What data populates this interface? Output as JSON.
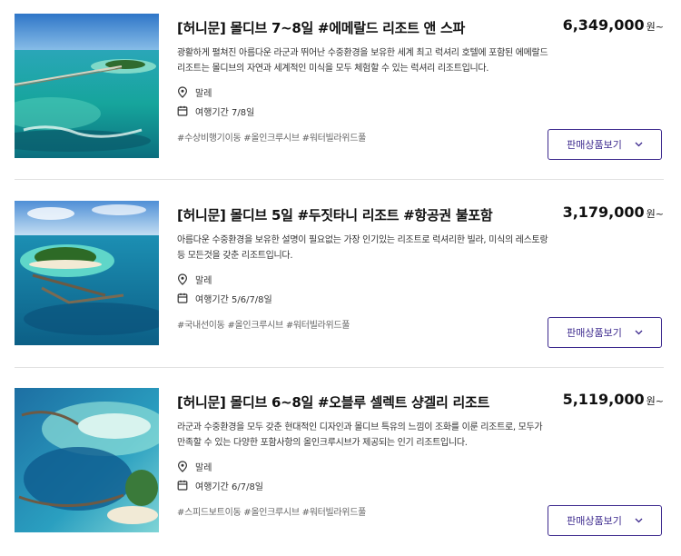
{
  "products": [
    {
      "title": "[허니문] 몰디브 7~8일 #에메랄드 리조트 앤 스파",
      "description": "광활하게 펼쳐진 아름다운 라군과 뛰어난 수중환경을 보유한 세계 최고 럭셔리 호텔에 포함된 에메랄드 리조트는 몰디브의 자연과 세계적인 미식을 모두 체험할 수 있는 럭셔리 리조트입니다.",
      "location": "말레",
      "duration": "여행기간 7/8일",
      "tags": "#수상비행기이동 #올인크루시브 #워터빌라위드풀",
      "price": "6,349,000",
      "price_unit": "원~",
      "button_label": "판매상품보기"
    },
    {
      "title": "[허니문] 몰디브 5일 #두짓타니 리조트 #항공권 불포함",
      "description": "아름다운 수중환경을 보유한 설명이 필요없는 가장 인기있는 리조트로 럭셔리한 빌라, 미식의 레스토랑 등 모든것을 갖춘 리조트입니다.",
      "location": "말레",
      "duration": "여행기간 5/6/7/8일",
      "tags": "#국내선이동 #올인크루시브 #워터빌라위드풀",
      "price": "3,179,000",
      "price_unit": "원~",
      "button_label": "판매상품보기"
    },
    {
      "title": "[허니문] 몰디브 6~8일 #오블루 셀렉트 샹겔리 리조트",
      "description": "라군과 수중환경을 모두 갖춘 현대적인 디자인과 몰디브 특유의 느낌이 조화를 이룬 리조트로, 모두가 만족할 수 있는 다양한 포함사항의 올인크루시브가 제공되는 인기 리조트입니다.",
      "location": "말레",
      "duration": "여행기간 6/7/8일",
      "tags": "#스피드보트이동 #올인크루시브 #워터빌라위드풀",
      "price": "5,119,000",
      "price_unit": "원~",
      "button_label": "판매상품보기"
    }
  ],
  "icons": {
    "location": "map-pin-icon",
    "duration": "calendar-icon",
    "button": "chevron-down-icon"
  },
  "colors": {
    "accent": "#3d2a8e",
    "text": "#222222",
    "tag_text": "#666666",
    "divider": "#e2e2e2"
  }
}
